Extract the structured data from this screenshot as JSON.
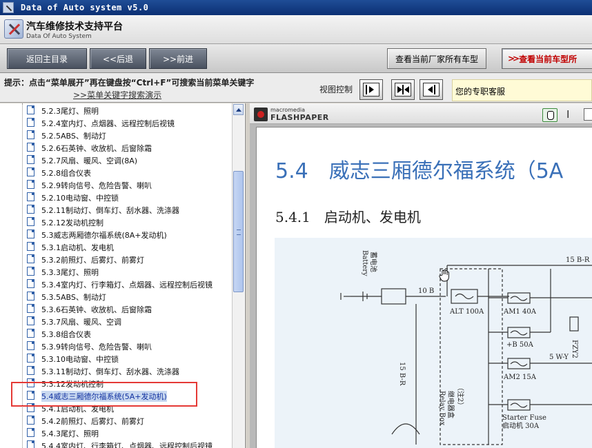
{
  "window": {
    "title": "Data of Auto system v5.0"
  },
  "header": {
    "brand_title": "汽车维修技术支持平台",
    "brand_subtitle": "Data Of Auto System"
  },
  "toolbar": {
    "home": "返回主目录",
    "back": "<<后退",
    "forward": ">>前进",
    "all_models": "查看当前厂家所有车型",
    "current_models": "查看当前车型所"
  },
  "tipbar": {
    "tip": "提示：点击“菜单展开”再在键盘按“Ctrl+F”可搜索当前菜单关键字",
    "link": ">>菜单关键字搜索演示",
    "view_label": "视图控制",
    "support": "您的专职客服"
  },
  "tree": {
    "items": [
      {
        "label": "5.2.3尾灯、照明"
      },
      {
        "label": "5.2.4室内灯、点烟器、远程控制后视镜"
      },
      {
        "label": "5.2.5ABS、制动灯"
      },
      {
        "label": "5.2.6石英钟、收放机、后窗除霜"
      },
      {
        "label": "5.2.7风扇、暖风、空调(8A)"
      },
      {
        "label": "5.2.8组合仪表"
      },
      {
        "label": "5.2.9转向信号、危险告警、喇叭"
      },
      {
        "label": "5.2.10电动窗、中控锁"
      },
      {
        "label": "5.2.11制动灯、倒车灯、刮水器、洗涤器"
      },
      {
        "label": "5.2.12发动机控制"
      },
      {
        "label": "5.3威志两厢德尔福系统(8A+发动机)"
      },
      {
        "label": "5.3.1启动机、发电机"
      },
      {
        "label": "5.3.2前照灯、后雾灯、前雾灯"
      },
      {
        "label": "5.3.3尾灯、照明"
      },
      {
        "label": "5.3.4室内灯、行李箱灯、点烟器、远程控制后视镜"
      },
      {
        "label": "5.3.5ABS、制动灯"
      },
      {
        "label": "5.3.6石英钟、收放机、后窗除霜"
      },
      {
        "label": "5.3.7风扇、暖风、空调"
      },
      {
        "label": "5.3.8组合仪表"
      },
      {
        "label": "5.3.9转向信号、危险告警、喇叭"
      },
      {
        "label": "5.3.10电动窗、中控锁"
      },
      {
        "label": "5.3.11制动灯、倒车灯、刮水器、洗涤器"
      },
      {
        "label": "5.3.12发动机控制"
      },
      {
        "label": "5.4威志三厢德尔福系统(5A+发动机)"
      },
      {
        "label": "5.4.1启动机、发电机"
      },
      {
        "label": "5.4.2前照灯、后雾灯、前雾灯"
      },
      {
        "label": "5.4.3尾灯、照明"
      },
      {
        "label": "5.4.4室内灯、行李箱灯、点烟器、远程控制后视镜"
      }
    ]
  },
  "viewer": {
    "brand_small": "macromedia",
    "brand_name": "FLASHPAPER",
    "section_title": "5.4　威志三厢德尔福系统（5A",
    "subsection_title": "5.4.1　启动机、发电机",
    "diagram": {
      "battery": "蓄电池",
      "battery_en": "Battery",
      "wire_10b": "10 B",
      "wire_15br_top": "15 B-R",
      "wire_15br_side": "15 B-R",
      "alt": "ALT 100A",
      "am1": "AM1 40A",
      "b50": "+B 50A",
      "am2": "AM2 15A",
      "starter_fuse": "Starter Fuse",
      "starter_fuse_cn": "启动机 30A",
      "relay_box_cn": "继电器盒",
      "relay_box_en": "Relay Box",
      "note": "（注2）",
      "wire_5wy": "5 W-Y",
      "fzy2": "FZY2"
    }
  },
  "colors": {
    "highlight": "#e53935",
    "heading_blue": "#3a70b8",
    "title_bar": "#0b2f73"
  }
}
